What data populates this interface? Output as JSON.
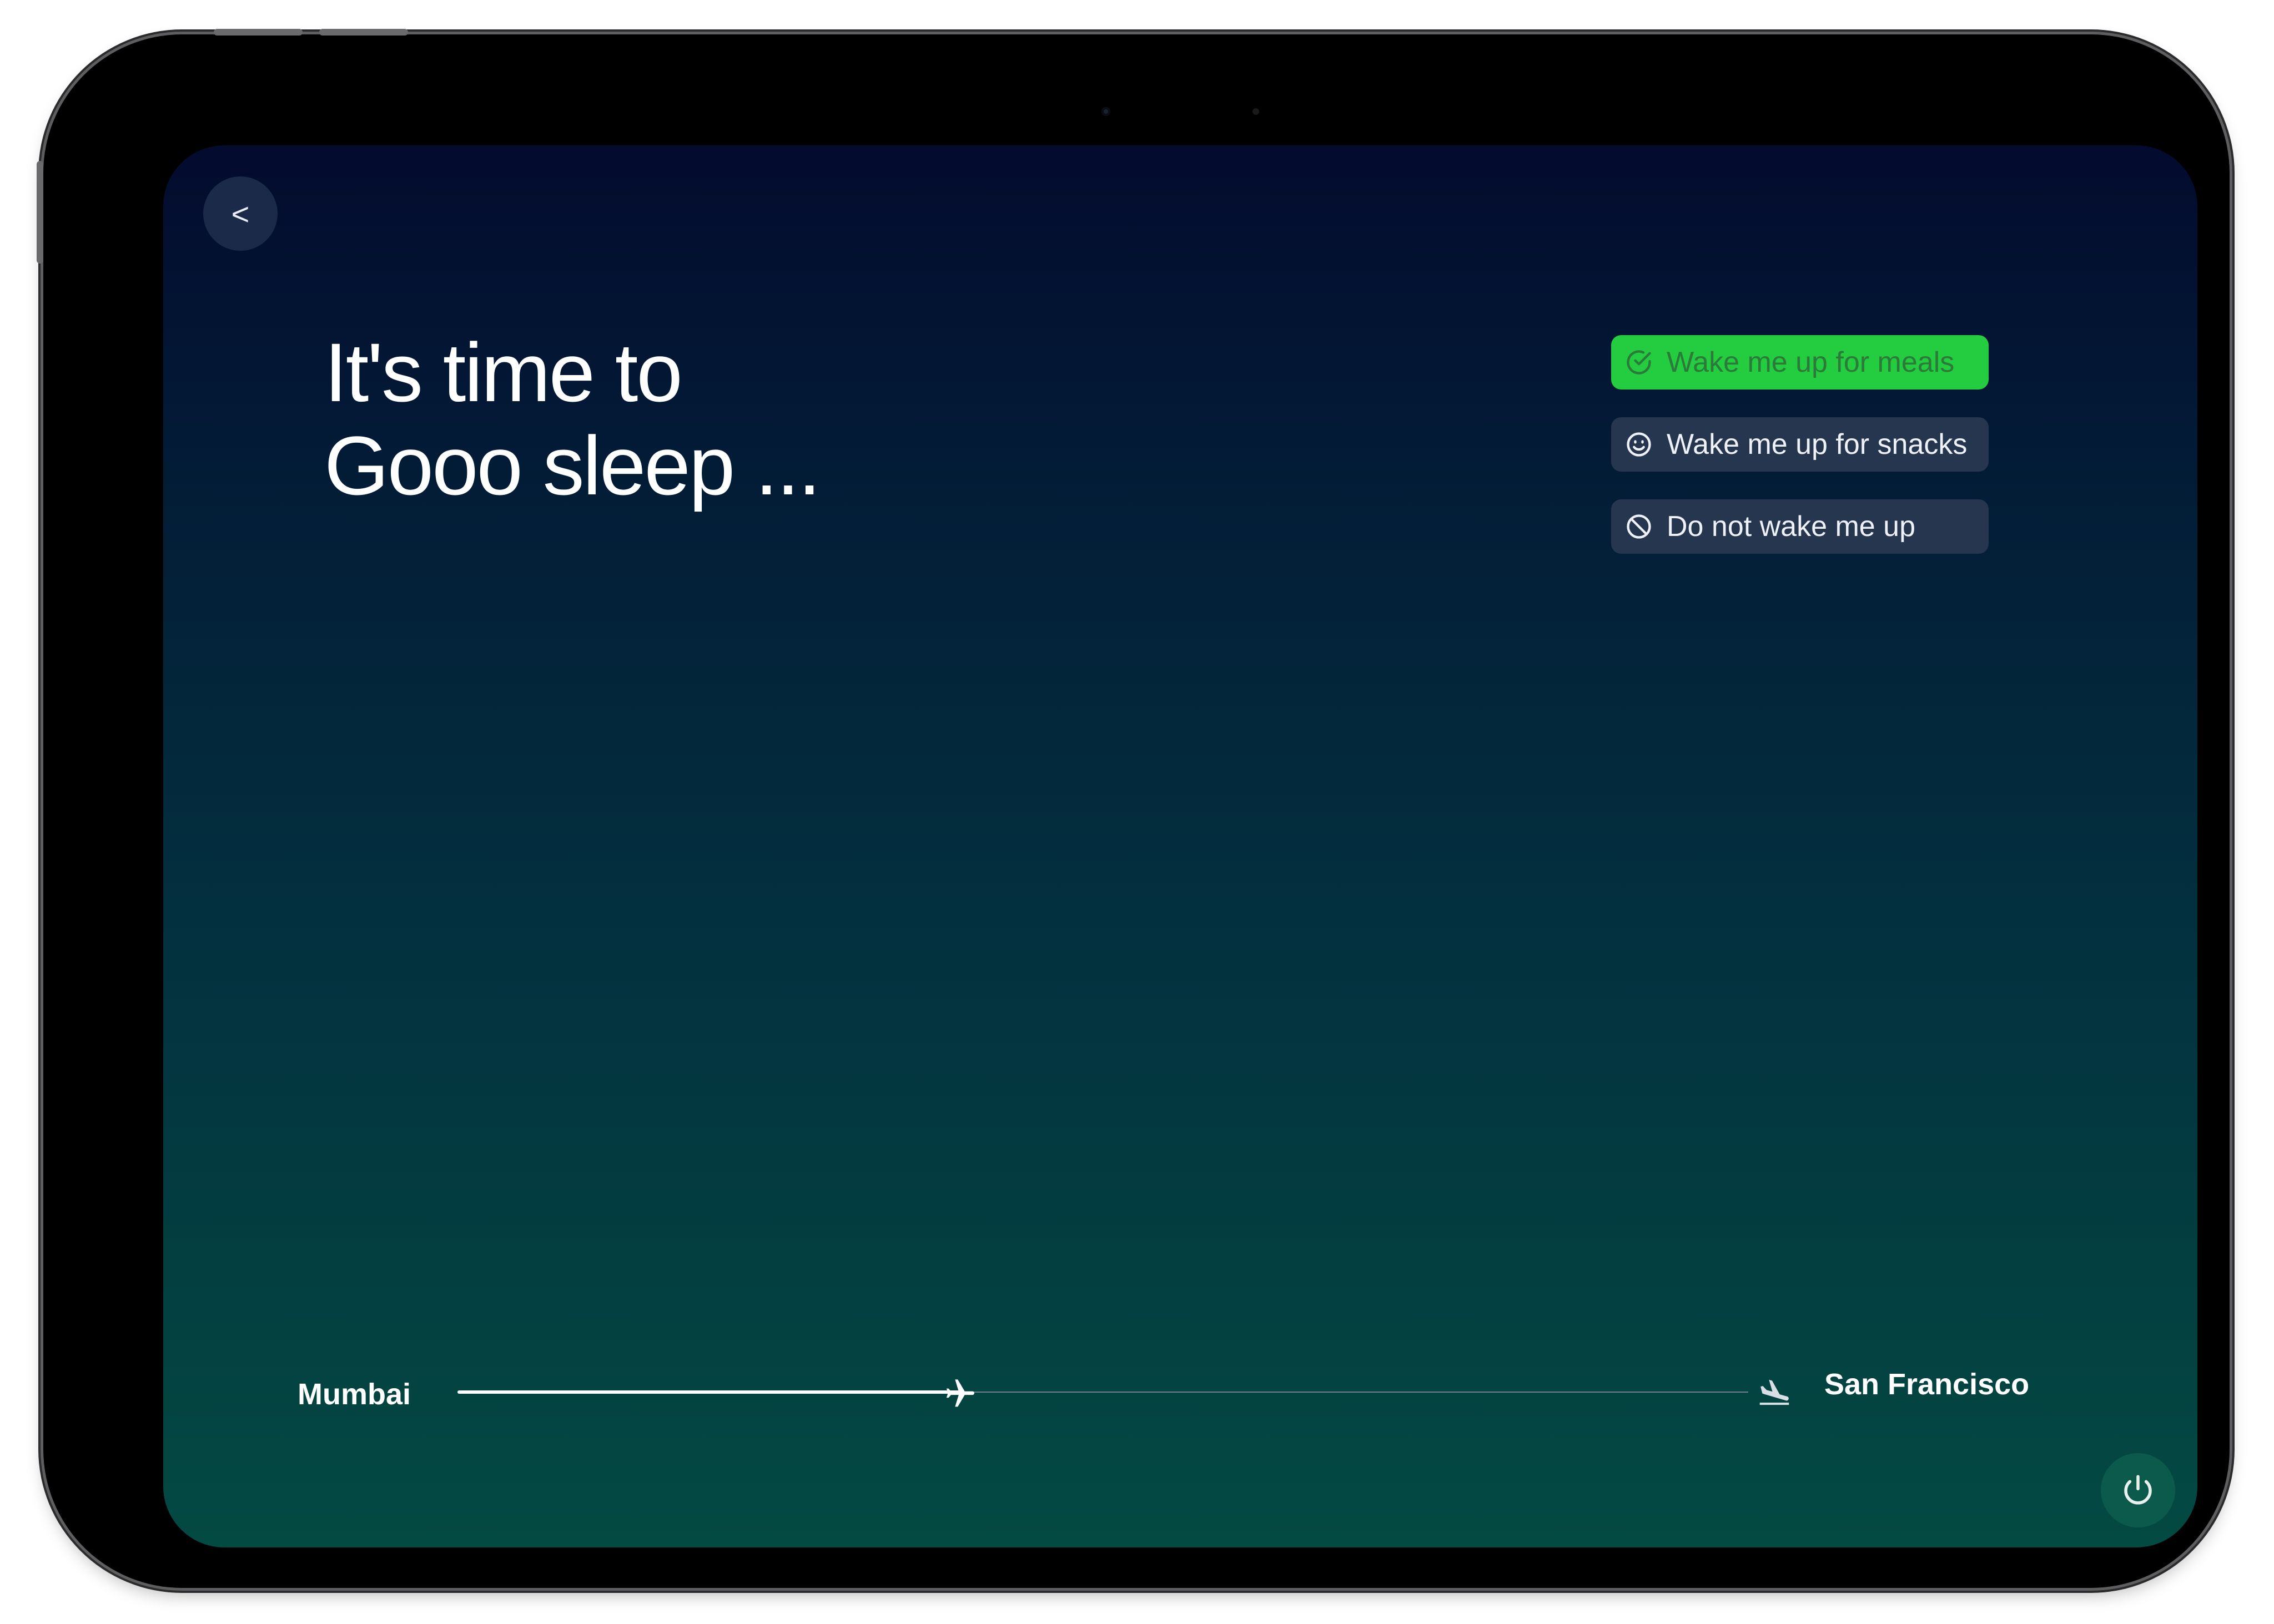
{
  "header": {
    "back_label": "<"
  },
  "headline": {
    "line1": "It's time to",
    "line2": "Gooo sleep ..."
  },
  "wake_options": [
    {
      "label": "Wake me up for meals",
      "icon": "check-circle-icon",
      "selected": true
    },
    {
      "label": "Wake me up for snacks",
      "icon": "smiley-icon",
      "selected": false
    },
    {
      "label": "Do not wake me up",
      "icon": "prohibited-icon",
      "selected": false
    }
  ],
  "flight": {
    "origin": "Mumbai",
    "destination": "San Francisco",
    "progress": 0.39
  },
  "colors": {
    "accent_green": "#24cc40",
    "option_background": "#27364f",
    "gradient_top": "#030b2e",
    "gradient_bottom": "#034a42"
  },
  "icons": {
    "plane": "airplane-icon",
    "arrival": "airplane-landing-icon",
    "power": "power-icon"
  }
}
